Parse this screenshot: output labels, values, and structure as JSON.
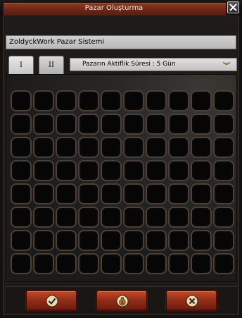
{
  "window": {
    "title": "Pazar Oluşturma",
    "close_icon": "close-icon"
  },
  "shop": {
    "name": "ZoldyckWork Pazar Sistemi"
  },
  "tabs": [
    {
      "label": "I",
      "active": true
    },
    {
      "label": "II",
      "active": false
    }
  ],
  "duration": {
    "selected": "Pazarın Aktiflik Süresi : 5 Gün",
    "icon": "chevron-down-icon"
  },
  "grid": {
    "rows": 8,
    "cols": 10
  },
  "buttons": {
    "confirm_icon": "check-icon",
    "money_icon": "money-bag-icon",
    "cancel_icon": "close-icon"
  },
  "colors": {
    "title_plate": "#7a2c18",
    "button_red": "#a63a1f",
    "slot_border": "#4a4036"
  }
}
